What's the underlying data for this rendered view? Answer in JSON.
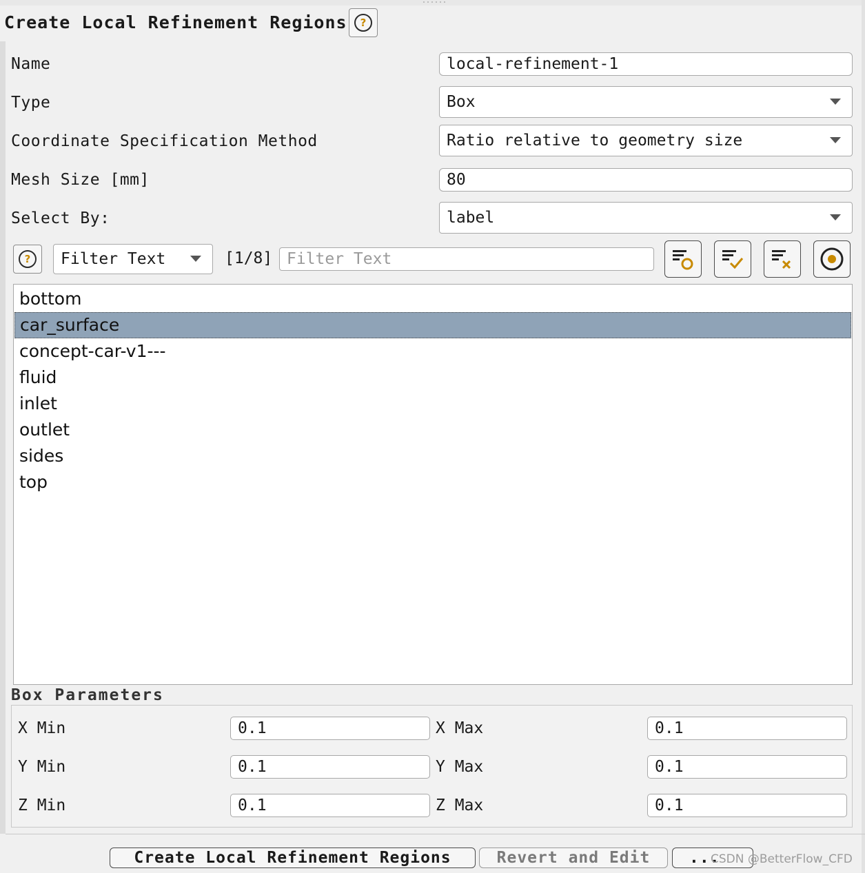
{
  "panel": {
    "title": "Create Local Refinement Regions",
    "help_icon": "question-circle-icon"
  },
  "form": {
    "name_label": "Name",
    "name_value": "local-refinement-1",
    "type_label": "Type",
    "type_value": "Box",
    "coord_label": "Coordinate Specification Method",
    "coord_value": "Ratio relative to geometry size",
    "mesh_label": "Mesh Size [mm]",
    "mesh_value": "80",
    "select_label": "Select By:",
    "select_value": "label"
  },
  "filter": {
    "type_value": "Filter Text",
    "count": "[1/8]",
    "placeholder": "Filter Text",
    "tools": [
      "filter-highlight-icon",
      "filter-select-all-icon",
      "filter-clear-icon",
      "radio-target-icon"
    ]
  },
  "list": {
    "items": [
      "bottom",
      "car_surface",
      "concept-car-v1---",
      "fluid",
      "inlet",
      "outlet",
      "sides",
      "top"
    ],
    "selected": "car_surface"
  },
  "box_parameters": {
    "title": "Box Parameters",
    "x_min_label": "X Min",
    "x_min": "0.1",
    "x_max_label": "X Max",
    "x_max": "0.1",
    "y_min_label": "Y Min",
    "y_min": "0.1",
    "y_max_label": "Y Max",
    "y_max": "0.1",
    "z_min_label": "Z Min",
    "z_min": "0.1",
    "z_max_label": "Z Max",
    "z_max": "0.1"
  },
  "actions": {
    "create": "Create Local Refinement Regions",
    "revert": "Revert and Edit",
    "more": "...",
    "watermark": "CSDN @BetterFlow_CFD"
  },
  "colors": {
    "selection": "#8fa3b7",
    "help_accent": "#c88a00",
    "tool_accent": "#c88a00"
  }
}
